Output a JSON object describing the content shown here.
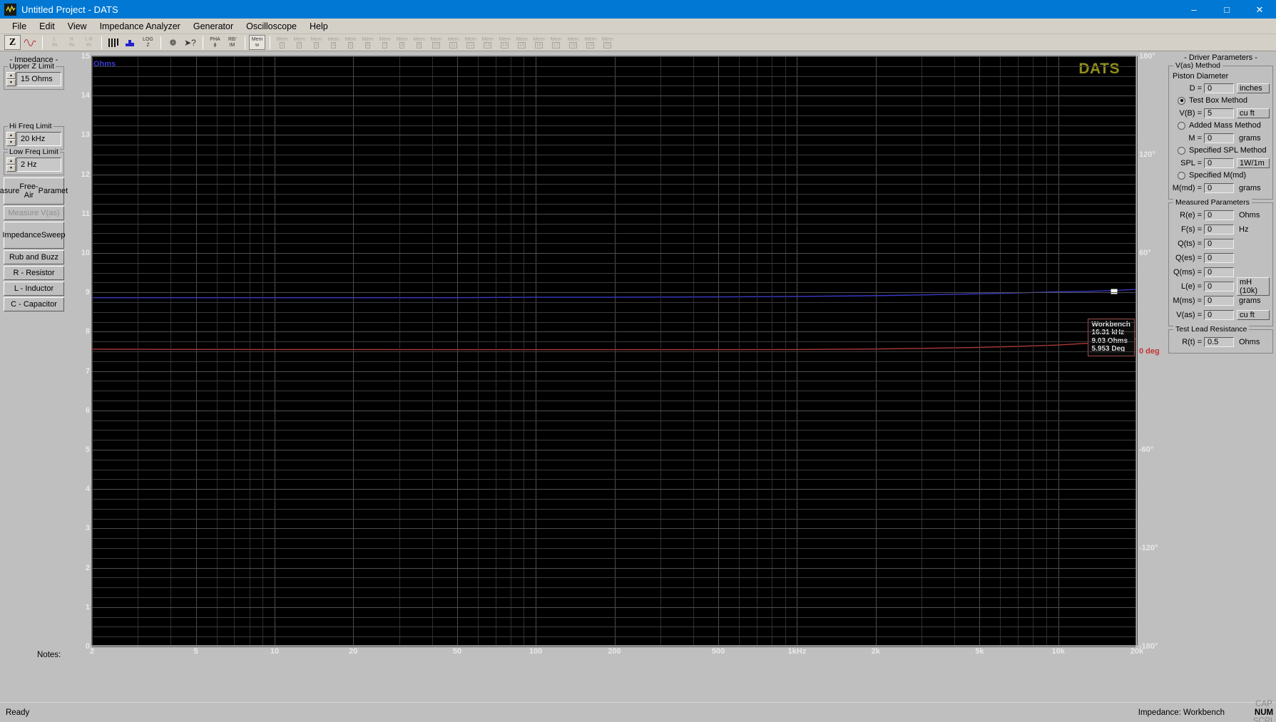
{
  "window": {
    "title": "Untitled Project - DATS",
    "logo_icon": "waveform-icon",
    "minimize": "–",
    "maximize": "□",
    "close": "✕"
  },
  "menu": {
    "items": [
      "File",
      "Edit",
      "View",
      "Impedance Analyzer",
      "Generator",
      "Oscilloscope",
      "Help"
    ]
  },
  "toolbar": {
    "groups": [
      {
        "buttons": [
          {
            "name": "impedance-z-button",
            "kind": "z",
            "label": "Z",
            "state": "active"
          },
          {
            "name": "sine-wave-button",
            "kind": "sine",
            "label": "",
            "state": "normal"
          }
        ]
      },
      {
        "buttons": [
          {
            "name": "left-in-button",
            "kind": "two",
            "top": "L",
            "bottom": "IN",
            "state": "disabled"
          },
          {
            "name": "right-in-button",
            "kind": "two",
            "top": "R",
            "bottom": "IN",
            "state": "disabled"
          },
          {
            "name": "left-right-in-button",
            "kind": "two",
            "top": "L R",
            "bottom": "IN",
            "state": "disabled"
          }
        ]
      },
      {
        "buttons": [
          {
            "name": "bar-graph-button",
            "kind": "bars",
            "label": "",
            "state": "normal"
          },
          {
            "name": "waterfall-button",
            "kind": "block",
            "label": "",
            "state": "normal"
          },
          {
            "name": "log-z-button",
            "kind": "two",
            "top": "LOG",
            "bottom": "Z",
            "state": "normal"
          }
        ]
      },
      {
        "buttons": [
          {
            "name": "help-button",
            "kind": "glyph",
            "label": "❁",
            "state": "normal"
          },
          {
            "name": "context-help-button",
            "kind": "glyph",
            "label": "➤?",
            "state": "normal"
          }
        ]
      },
      {
        "buttons": [
          {
            "name": "phase-button",
            "kind": "two",
            "top": "PHA",
            "bottom": "ϕ",
            "state": "normal"
          },
          {
            "name": "real-imaginary-button",
            "kind": "two",
            "top": "RE⁄",
            "bottom": "IM",
            "state": "normal"
          }
        ]
      },
      {
        "buttons": [
          {
            "name": "mem-w-button",
            "kind": "two",
            "top": "Mem",
            "bottom": "w",
            "state": "active"
          }
        ]
      }
    ],
    "memory_label": "Mem",
    "memory_slots": [
      "1",
      "2",
      "3",
      "4",
      "5",
      "6",
      "7",
      "8",
      "9",
      "10",
      "11",
      "12",
      "13",
      "14",
      "15",
      "16",
      "17",
      "18",
      "19",
      "20"
    ]
  },
  "left_panel": {
    "header": "- Impedance -",
    "upper_z": {
      "title": "Upper Z Limit",
      "value": "15 Ohms"
    },
    "hi_freq": {
      "title": "Hi Freq Limit",
      "value": "20 kHz"
    },
    "low_freq": {
      "title": "Low Freq Limit",
      "value": "2 Hz"
    },
    "buttons": [
      {
        "name": "measure-free-air-parameters-button",
        "label": "Measure\nFree-Air\nParameters",
        "disabled": false,
        "tall": true
      },
      {
        "name": "measure-vas-button",
        "label": "Measure V(as)",
        "disabled": true,
        "tall": false
      },
      {
        "name": "impedance-sweep-button",
        "label": "Impedance\nSweep",
        "disabled": false,
        "tall": true
      },
      {
        "name": "rub-and-buzz-button",
        "label": "Rub and Buzz",
        "disabled": false,
        "tall": false
      },
      {
        "name": "r-resistor-button",
        "label": "R - Resistor",
        "disabled": false,
        "tall": false
      },
      {
        "name": "l-inductor-button",
        "label": "L - Inductor",
        "disabled": false,
        "tall": false
      },
      {
        "name": "c-capacitor-button",
        "label": "C - Capacitor",
        "disabled": false,
        "tall": false
      }
    ],
    "notes_label": "Notes:"
  },
  "right_panel": {
    "header": "- Driver Parameters -",
    "vas_group": {
      "title": "V(as) Method",
      "piston_label": "Piston Diameter",
      "rows": [
        {
          "name": "piston-diameter-field",
          "label": "D =",
          "value": "0",
          "unit": "inches",
          "unit_boxed": true
        },
        {
          "name": "test-box-volume-field",
          "label": "V(B) =",
          "value": "5",
          "unit": "cu ft",
          "unit_boxed": true
        },
        {
          "name": "added-mass-field",
          "label": "M =",
          "value": "0",
          "unit": "grams",
          "unit_boxed": false
        },
        {
          "name": "specified-spl-field",
          "label": "SPL =",
          "value": "0",
          "unit": "1W/1m",
          "unit_boxed": true
        },
        {
          "name": "specified-mmd-field",
          "label": "M(md) =",
          "value": "0",
          "unit": "grams",
          "unit_boxed": false
        }
      ],
      "radios": [
        {
          "name": "radio-test-box-method",
          "label": "Test Box Method",
          "selected": true
        },
        {
          "name": "radio-added-mass-method",
          "label": "Added Mass Method",
          "selected": false
        },
        {
          "name": "radio-specified-spl-method",
          "label": "Specified SPL Method",
          "selected": false
        },
        {
          "name": "radio-specified-mmd",
          "label": "Specified M(md)",
          "selected": false
        }
      ]
    },
    "measured_group": {
      "title": "Measured Parameters",
      "rows": [
        {
          "name": "re-field",
          "label": "R(e) =",
          "value": "0",
          "unit": "Ohms",
          "unit_boxed": false
        },
        {
          "name": "fs-field",
          "label": "F(s) =",
          "value": "0",
          "unit": "Hz",
          "unit_boxed": false
        },
        {
          "name": "qts-field",
          "label": "Q(ts) =",
          "value": "0",
          "unit": "",
          "unit_boxed": false
        },
        {
          "name": "qes-field",
          "label": "Q(es) =",
          "value": "0",
          "unit": "",
          "unit_boxed": false
        },
        {
          "name": "qms-field",
          "label": "Q(ms) =",
          "value": "0",
          "unit": "",
          "unit_boxed": false
        },
        {
          "name": "le-field",
          "label": "L(e) =",
          "value": "0",
          "unit": "mH (10k)",
          "unit_boxed": true
        },
        {
          "name": "mms-field",
          "label": "M(ms) =",
          "value": "0",
          "unit": "grams",
          "unit_boxed": false
        },
        {
          "name": "vas-field",
          "label": "V(as) =",
          "value": "0",
          "unit": "cu ft",
          "unit_boxed": true
        }
      ]
    },
    "lead_group": {
      "title": "Test Lead Resistance",
      "rows": [
        {
          "name": "test-lead-resistance-field",
          "label": "R(t) =",
          "value": "0.5",
          "unit": "Ohms",
          "unit_boxed": false
        }
      ]
    }
  },
  "cursor_readout": {
    "title": "Workbench",
    "frequency": "16.31 kHz",
    "impedance": "9.03 Ohms",
    "phase": "5.953 Deg"
  },
  "status_bar": {
    "message": "Ready",
    "mode": "Impedance: Workbench",
    "indicators": [
      {
        "label": "CAP",
        "active": false
      },
      {
        "label": "NUM",
        "active": true
      },
      {
        "label": "SCRL",
        "active": false
      }
    ]
  },
  "chart_data": {
    "type": "line",
    "title": "",
    "watermark": "DATS",
    "xlabel": "",
    "ylabel": "Ohms",
    "y2label": "deg",
    "xscale": "log",
    "xlim": [
      2,
      20000
    ],
    "ylim": [
      0,
      15
    ],
    "y2lim": [
      -180,
      180
    ],
    "grid": true,
    "background": "#000000",
    "x_ticks": [
      {
        "value": 2,
        "label": "2"
      },
      {
        "value": 5,
        "label": "5"
      },
      {
        "value": 10,
        "label": "10"
      },
      {
        "value": 20,
        "label": "20"
      },
      {
        "value": 50,
        "label": "50"
      },
      {
        "value": 100,
        "label": "100"
      },
      {
        "value": 200,
        "label": "200"
      },
      {
        "value": 500,
        "label": "500"
      },
      {
        "value": 1000,
        "label": "1kHz"
      },
      {
        "value": 2000,
        "label": "2k"
      },
      {
        "value": 5000,
        "label": "5k"
      },
      {
        "value": 10000,
        "label": "10k"
      },
      {
        "value": 20000,
        "label": "20k"
      }
    ],
    "y_ticks": [
      {
        "value": 15,
        "label": "15"
      },
      {
        "value": 14,
        "label": "14"
      },
      {
        "value": 13,
        "label": "13"
      },
      {
        "value": 12,
        "label": "12"
      },
      {
        "value": 11,
        "label": "11"
      },
      {
        "value": 10,
        "label": "10"
      },
      {
        "value": 9,
        "label": "9"
      },
      {
        "value": 8,
        "label": "8"
      },
      {
        "value": 7,
        "label": "7"
      },
      {
        "value": 6,
        "label": "6"
      },
      {
        "value": 5,
        "label": "5"
      },
      {
        "value": 4,
        "label": "4"
      },
      {
        "value": 3,
        "label": "3"
      },
      {
        "value": 2,
        "label": "2"
      },
      {
        "value": 1,
        "label": "1"
      },
      {
        "value": 0,
        "label": "0"
      }
    ],
    "y2_ticks": [
      {
        "value": 180,
        "label": "180°"
      },
      {
        "value": 120,
        "label": "120°"
      },
      {
        "value": 60,
        "label": "60°"
      },
      {
        "value": 0,
        "label": "0 deg"
      },
      {
        "value": -60,
        "label": "-60°"
      },
      {
        "value": -120,
        "label": "-120°"
      },
      {
        "value": -180,
        "label": "-180°"
      }
    ],
    "series": [
      {
        "name": "Phase",
        "color": "#b03a3a",
        "axis": "y2",
        "x": [
          2,
          5,
          10,
          20,
          50,
          100,
          200,
          500,
          1000,
          2000,
          3000,
          5000,
          7000,
          10000,
          13000,
          16310,
          20000
        ],
        "values": [
          0.9,
          0.8,
          0.7,
          0.7,
          0.6,
          0.6,
          0.6,
          0.6,
          0.7,
          1.0,
          1.4,
          2.0,
          2.6,
          3.4,
          4.5,
          5.953,
          7.2
        ]
      },
      {
        "name": "Impedance",
        "color": "#3a3ac8",
        "axis": "y",
        "x": [
          2,
          5,
          10,
          20,
          50,
          100,
          200,
          500,
          1000,
          2000,
          3000,
          5000,
          7000,
          10000,
          13000,
          16310,
          20000
        ],
        "values": [
          8.85,
          8.85,
          8.85,
          8.85,
          8.85,
          8.86,
          8.86,
          8.87,
          8.88,
          8.9,
          8.92,
          8.95,
          8.97,
          9.0,
          9.01,
          9.03,
          9.06
        ]
      }
    ],
    "markers": [
      {
        "series": "Phase",
        "x": 16310,
        "value": 5.953
      },
      {
        "series": "Impedance",
        "x": 16310,
        "value": 9.03
      }
    ]
  }
}
